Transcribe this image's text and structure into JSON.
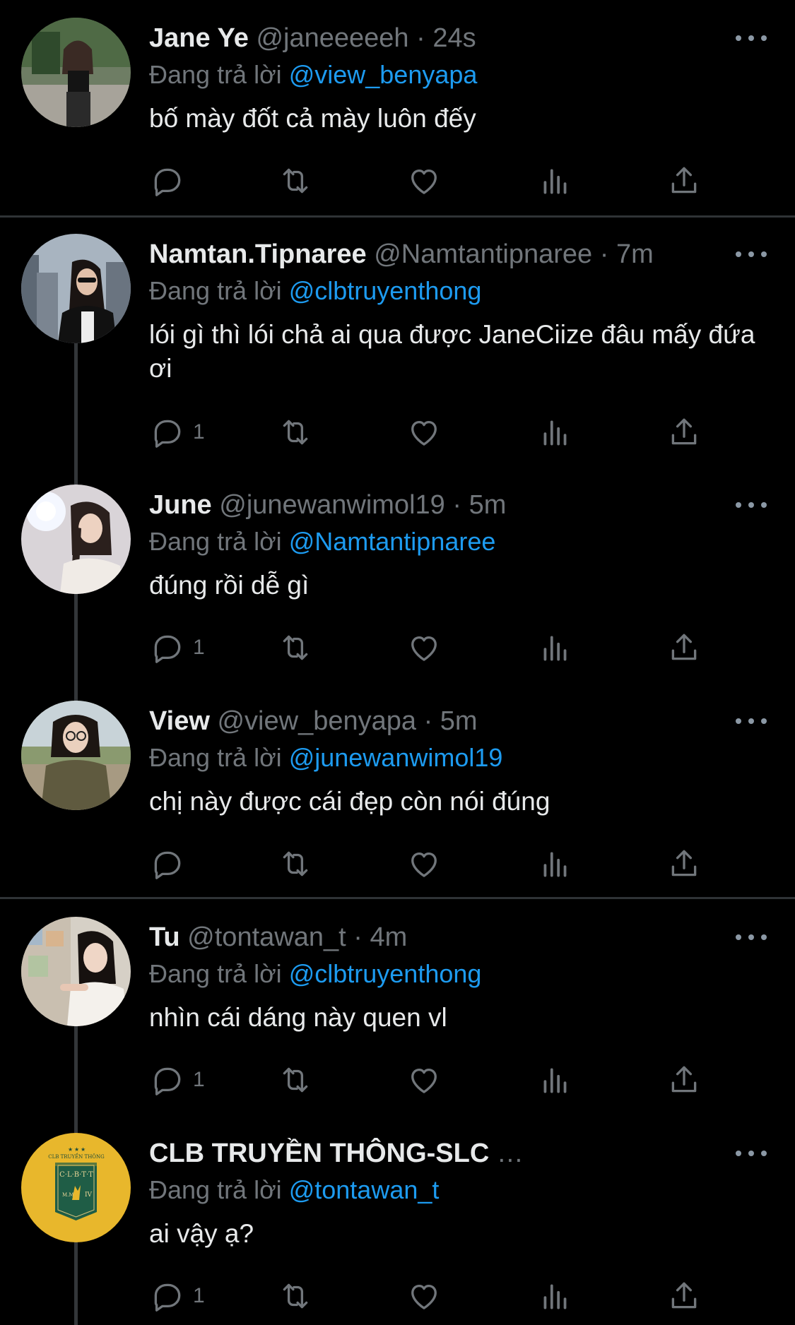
{
  "reply_prefix": "Đang trả lời",
  "dot": "·",
  "colors": {
    "background": "#000000",
    "text": "#e7e9ea",
    "secondary": "#71767b",
    "link": "#1d9bf0",
    "divider": "#2f3336"
  },
  "tweets": [
    {
      "display_name": "Jane Ye",
      "handle": "@janeeeeeh",
      "time": "24s",
      "reply_to": "@view_benyapa",
      "text": "bố mày đốt cả mày luôn đếy",
      "reply_count": "",
      "avatar_icon": "avatar-photo-icon"
    },
    {
      "display_name": "Namtan.Tipnaree",
      "handle": "@Namtantipnaree",
      "time": "7m",
      "reply_to": "@clbtruyenthong",
      "text": "lói gì thì lói chả ai qua được JaneCiize đâu mấy đứa ơi",
      "reply_count": "1",
      "avatar_icon": "avatar-photo-icon"
    },
    {
      "display_name": "June",
      "handle": "@junewanwimol19",
      "time": "5m",
      "reply_to": "@Namtantipnaree",
      "text": "đúng rồi dễ gì",
      "reply_count": "1",
      "avatar_icon": "avatar-photo-icon"
    },
    {
      "display_name": "View",
      "handle": "@view_benyapa",
      "time": "5m",
      "reply_to": "@junewanwimol19",
      "text": "chị này được cái đẹp còn nói đúng",
      "reply_count": "",
      "avatar_icon": "avatar-photo-icon"
    },
    {
      "display_name": "Tu",
      "handle": "@tontawan_t",
      "time": "4m",
      "reply_to": "@clbtruyenthong",
      "text": "nhìn cái dáng này quen vl",
      "reply_count": "1",
      "avatar_icon": "avatar-photo-icon"
    },
    {
      "display_name": "CLB TRUYỀN THÔNG-SLC",
      "handle": "…",
      "time": "",
      "reply_to": "@tontawan_t",
      "text": "ai vậy ạ?",
      "reply_count": "1",
      "avatar_icon": "club-logo-icon",
      "logo_top_text": "CLB TRUYỀN THÔNG",
      "logo_mid_text": "C·L·B·T·T",
      "logo_left_text": "M.M",
      "logo_right_text": "IV"
    }
  ]
}
